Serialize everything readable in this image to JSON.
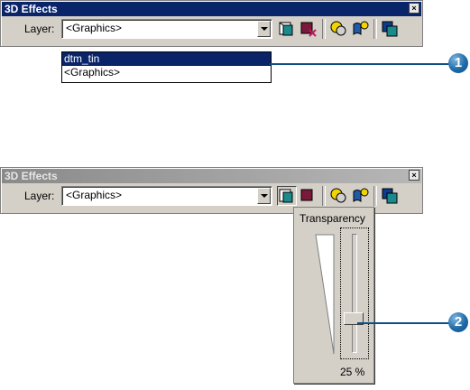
{
  "top_panel": {
    "title": "3D Effects",
    "layer_label": "Layer:",
    "layer_value": "<Graphics>",
    "dropdown_options": [
      "dtm_tin",
      "<Graphics>"
    ],
    "callout": "1"
  },
  "bottom_panel": {
    "title": "3D Effects",
    "layer_label": "Layer:",
    "layer_value": "<Graphics>",
    "transparency_title": "Transparency",
    "transparency_value": "25 %",
    "transparency_level_percent": 25,
    "callout": "2"
  },
  "icons": [
    "adjust-transparency-icon",
    "lighting-icon",
    "shading-icon",
    "face-culling-icon",
    "layer-face-icon"
  ],
  "colors": {
    "accent_blue": "#0a246a",
    "callout_blue": "#1f6aa8"
  }
}
